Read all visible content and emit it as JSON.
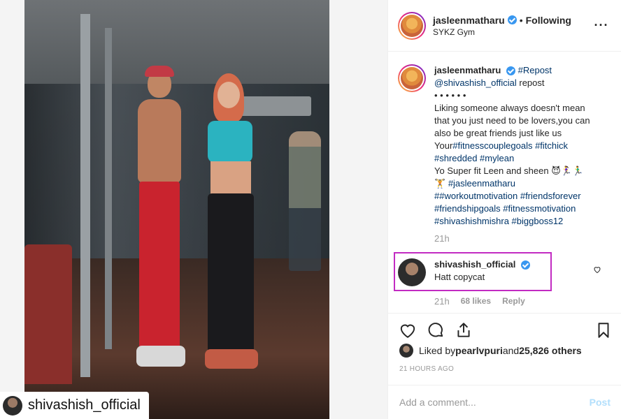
{
  "post": {
    "watermark_name": "shivashish_official"
  },
  "header": {
    "username": "jasleenmatharu",
    "separator": "•",
    "follow_status": "Following",
    "location": "SYKZ Gym",
    "more_icon": "more-horizontal-icon"
  },
  "caption": {
    "username": "jasleenmatharu",
    "repost_tag": "#Repost",
    "repost_user": "@shivashish_official",
    "repost_word": " repost",
    "dots": "• • • • • •",
    "text1": "Liking someone always doesn't mean that you just need to be lovers,you can also be great friends just like us",
    "text2_prefix": "Your",
    "tags1": "#fitnesscouplegoals #fitchick #shredded #mylean",
    "text3": "Yo Super fit Leen and sheen 😈🏃‍♀️🏃‍♂️",
    "text4_prefix": "🏋️ ",
    "tags2": "#jasleenmatharu",
    "tags3": "##workoutmotivation #friendsforever #friendshipgoals #fitnessmotivation #shivashishmishra #biggboss12",
    "time": "21h"
  },
  "comment": {
    "username": "shivashish_official",
    "text": "Hatt copycat",
    "time": "21h",
    "likes": "68 likes",
    "reply": "Reply"
  },
  "actions": {
    "like_icon": "heart-icon",
    "comment_icon": "comment-icon",
    "share_icon": "share-icon",
    "save_icon": "bookmark-icon"
  },
  "likes": {
    "prefix": "Liked by ",
    "user": "pearlvpuri",
    "and": " and ",
    "others": "25,826 others"
  },
  "posted_time": "21 HOURS AGO",
  "add_comment": {
    "placeholder": "Add a comment...",
    "post_label": "Post"
  },
  "colors": {
    "verified": "#3897f0",
    "link": "#003569",
    "highlight_box": "#c22bc2",
    "post_disabled": "#b2dffc"
  }
}
